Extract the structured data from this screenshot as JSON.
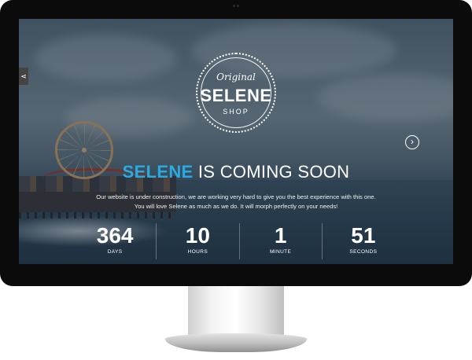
{
  "logo": {
    "script": "Original",
    "name": "SELENE",
    "sub": "SHOP"
  },
  "headline": {
    "accent": "SELENE",
    "rest": " IS COMING SOON"
  },
  "description": {
    "line1": "Our website is under construction, we are working very hard to give you the best experience with this one.",
    "line2": "You will love Selene as much as we do. It will morph perfectly on your needs!"
  },
  "countdown": [
    {
      "value": "364",
      "unit": "DAYS"
    },
    {
      "value": "10",
      "unit": "HOURS"
    },
    {
      "value": "1",
      "unit": "MINUTE"
    },
    {
      "value": "51",
      "unit": "SECONDS"
    }
  ],
  "icons": {
    "share": "share-icon",
    "next": "chevron-right-icon"
  },
  "colors": {
    "accent": "#29abe2",
    "bezel": "#0b0b0b",
    "text": "#ffffff"
  }
}
